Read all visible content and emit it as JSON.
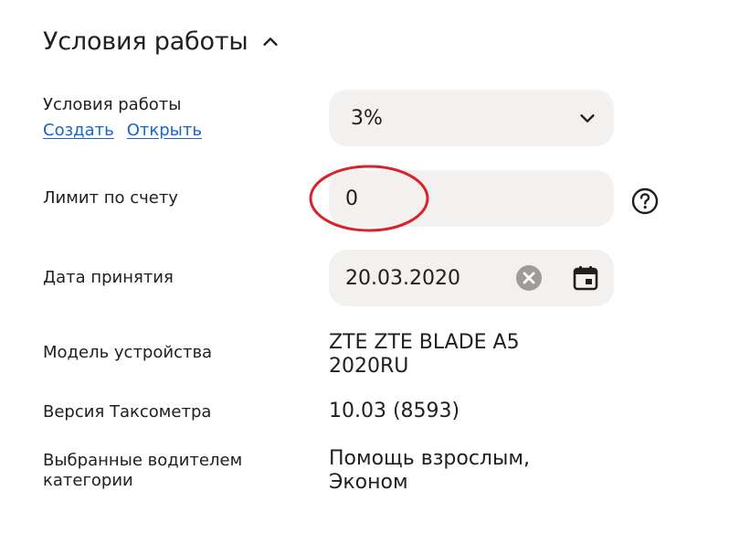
{
  "section": {
    "title": "Условия работы"
  },
  "work_conditions": {
    "label": "Условия работы",
    "create_link": "Создать",
    "open_link": "Открыть",
    "selected_value": "3%"
  },
  "account_limit": {
    "label": "Лимит по счету",
    "value": "0"
  },
  "acceptance_date": {
    "label": "Дата принятия",
    "value": "20.03.2020"
  },
  "device_model": {
    "label": "Модель устройства",
    "value_line1": "ZTE ZTE BLADE A5",
    "value_line2": "2020RU"
  },
  "taximeter_version": {
    "label": "Версия Таксометра",
    "value": "10.03 (8593)"
  },
  "driver_categories": {
    "label_line1": "Выбранные водителем",
    "label_line2": "категории",
    "value_line1": "Помощь взрослым,",
    "value_line2": "Эконом"
  },
  "icons": {
    "collapse": "chevron-up-icon",
    "dropdown": "chevron-down-icon",
    "help": "question-circle-icon",
    "clear": "clear-circle-icon",
    "calendar": "calendar-icon"
  },
  "colors": {
    "text": "#21201f",
    "link": "#1b63c7",
    "field_bg": "#f2f1ef",
    "annotation": "#d8232a",
    "clear_icon": "#9e9b98"
  }
}
